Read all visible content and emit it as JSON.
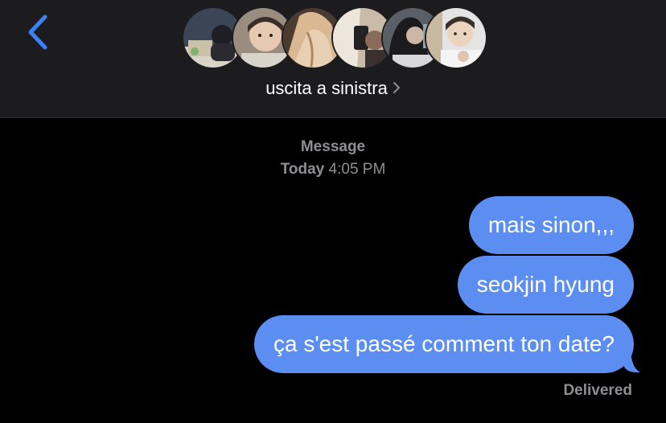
{
  "header": {
    "group_name": "uscita a sinistra",
    "avatars": [
      "avatar-1",
      "avatar-2",
      "avatar-3",
      "avatar-4",
      "avatar-5",
      "avatar-6"
    ]
  },
  "timestamp": {
    "kind": "Message",
    "day": "Today",
    "time": "4:05 PM"
  },
  "messages": [
    {
      "text": "mais sinon,,,",
      "from": "me"
    },
    {
      "text": "seokjin hyung",
      "from": "me"
    },
    {
      "text": "ça s'est passé comment ton date?",
      "from": "me"
    }
  ],
  "status": "Delivered",
  "colors": {
    "accent": "#3b82f6",
    "bubble": "#5c8ef2",
    "header_bg": "#1c1c1e",
    "background": "#000000",
    "muted_text": "#8e8e93"
  }
}
